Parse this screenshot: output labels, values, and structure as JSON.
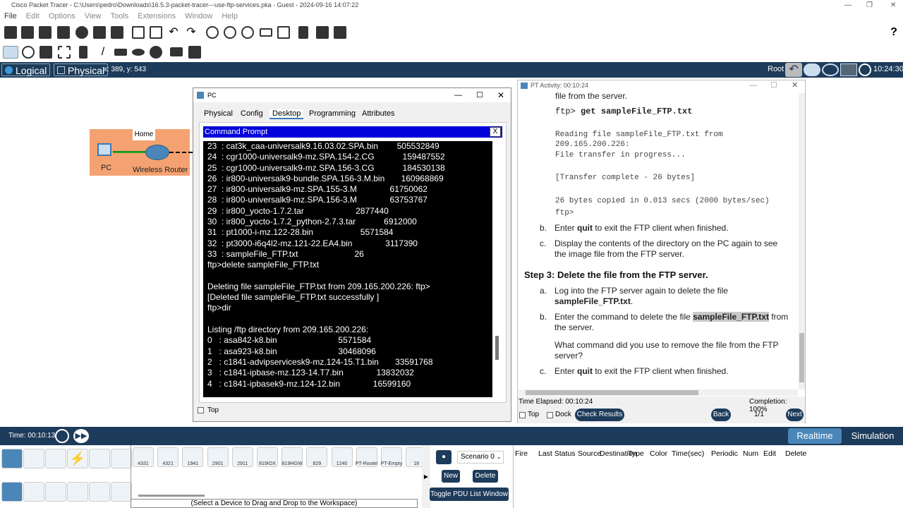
{
  "app": {
    "title": "Cisco Packet Tracer - C:\\Users\\pedro\\Downloads\\16.5.3-packet-tracer---use-ftp-services.pka - Guest - 2024-09-16 14:07:22"
  },
  "menu": [
    "File",
    "Edit",
    "Options",
    "View",
    "Tools",
    "Extensions",
    "Window",
    "Help"
  ],
  "tabs": {
    "logical": "Logical",
    "physical": "Physical",
    "coords": "x: 389, y: 543",
    "root": "Root",
    "clock": "10:24:30"
  },
  "topology": {
    "cluster_label": "Home",
    "device1": "PC",
    "device2": "Wireless Router"
  },
  "pc_window": {
    "title": "PC",
    "tabs": [
      "Physical",
      "Config",
      "Desktop",
      "Programming",
      "Attributes"
    ],
    "cmd_title": "Command Prompt",
    "close": "X",
    "top_label": "Top",
    "lines": [
      "23  : cat3k_caa-universalk9.16.03.02.SPA.bin        505532849",
      "24  : cgr1000-universalk9-mz.SPA.154-2.CG            159487552",
      "25  : cgr1000-universalk9-mz.SPA.156-3.CG            184530138",
      "26  : ir800-universalk9-bundle.SPA.156-3.M.bin       160968869",
      "27  : ir800-universalk9-mz.SPA.155-3.M              61750062",
      "28  : ir800-universalk9-mz.SPA.156-3.M              63753767",
      "29  : ir800_yocto-1.7.2.tar                      2877440",
      "30  : ir800_yocto-1.7.2_python-2.7.3.tar            6912000",
      "31  : pt1000-i-mz.122-28.bin                    5571584",
      "32  : pt3000-i6q4l2-mz.121-22.EA4.bin              3117390",
      "33  : sampleFile_FTP.txt                        26",
      "ftp>delete sampleFile_FTP.txt",
      "",
      "Deleting file sampleFile_FTP.txt from 209.165.200.226: ftp>",
      "[Deleted file sampleFile_FTP.txt successfully ]",
      "ftp>dir",
      "",
      "Listing /ftp directory from 209.165.200.226:",
      "0   : asa842-k8.bin                          5571584",
      "1   : asa923-k8.bin                          30468096",
      "2   : c1841-advipservicesk9-mz.124-15.T1.bin       33591768",
      "3   : c1841-ipbase-mz.123-14.T7.bin              13832032",
      "4   : c1841-ipbasek9-mz.124-12.bin              16599160"
    ]
  },
  "activity": {
    "title": "PT Activity: 00:10:24",
    "frag": "file from the server.",
    "ftp_cmd_prompt": "ftp>",
    "ftp_cmd": "get sampleFile_FTP.txt",
    "reading1": "Reading file sampleFile_FTP.txt from",
    "reading2": "209.165.200.226:",
    "transfer": "File transfer in progress...",
    "complete": "[Transfer complete - 26 bytes]",
    "copied": "26 bytes copied in 0.013 secs (2000 bytes/sec)",
    "ftp_prompt": "ftp>",
    "b_letter": "b.",
    "b_pre": "Enter ",
    "b_bold": "quit",
    "b_post": " to exit the FTP client when finished.",
    "c_letter": "c.",
    "c_text": "Display the contents of the directory on the PC again to see the image file from the FTP server.",
    "step3": "Step 3: Delete the file from the FTP server.",
    "s3a_letter": "a.",
    "s3a_text": "Log into the FTP server again to delete the file",
    "s3a_bold": "sampleFile_FTP.txt",
    "s3a_dot": ".",
    "s3b_letter": "b.",
    "s3b_pre": "Enter the command to delete the file ",
    "s3b_hl": "sampleFile_FTP.txt",
    "s3b_post": " from the server.",
    "question": "What command did you use to remove the file from the FTP server?",
    "s3c_letter": "c.",
    "s3c_pre": "Enter ",
    "s3c_bold": "quit",
    "s3c_post": " to exit the FTP client when finished.",
    "time_elapsed": "Time Elapsed: 00:10:24",
    "completion": "Completion: 100%",
    "top": "Top",
    "dock": "Dock",
    "check": "Check Results",
    "back": "Back",
    "page": "1/1",
    "next": "Next"
  },
  "bottom": {
    "time": "Time: 00:10:13",
    "realtime": "Realtime",
    "simulation": "Simulation"
  },
  "palette": {
    "models": [
      "4331",
      "4321",
      "1941",
      "2901",
      "2911",
      "819IOX",
      "819HGW",
      "829",
      "1240",
      "PT-Router",
      "PT-Empty",
      "18"
    ],
    "hint": "(Select a Device to Drag and Drop to the Workspace)"
  },
  "pdu": {
    "scenario": "Scenario 0",
    "new": "New",
    "delete": "Delete",
    "toggle": "Toggle PDU List Window",
    "columns": [
      "Fire",
      "Last Status",
      "Source",
      "Destination",
      "Type",
      "Color",
      "Time(sec)",
      "Periodic",
      "Num",
      "Edit",
      "Delete"
    ]
  }
}
